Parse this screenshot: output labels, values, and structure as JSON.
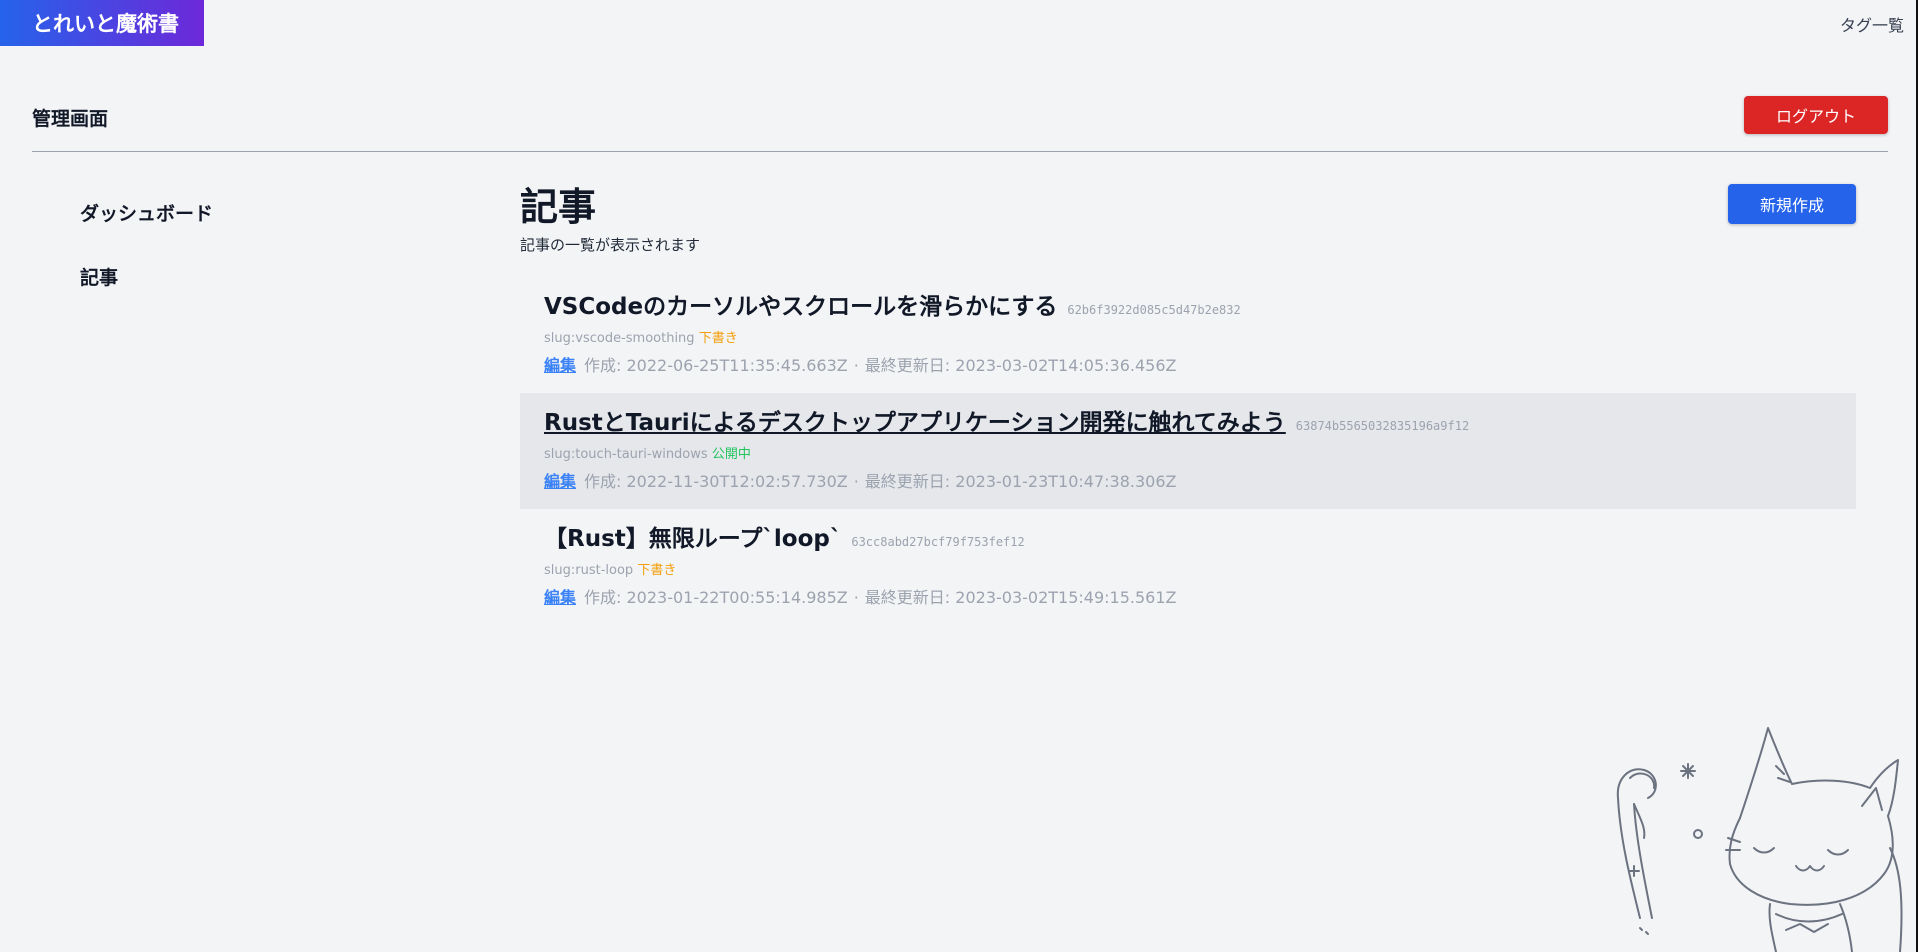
{
  "site": {
    "logo": "とれいと魔術書",
    "tags_link": "タグ一覧"
  },
  "admin": {
    "title": "管理画面",
    "logout_label": "ログアウト"
  },
  "sidebar": {
    "items": [
      {
        "label": "ダッシュボード"
      },
      {
        "label": "記事"
      }
    ]
  },
  "main": {
    "title": "記事",
    "description": "記事の一覧が表示されます",
    "new_label": "新規作成",
    "edit_label": "編集",
    "created_prefix": "作成: ",
    "updated_prefix": "最終更新日: ",
    "separator": "·",
    "articles": [
      {
        "title": "VSCodeのカーソルやスクロールを滑らかにする",
        "id": "62b6f3922d085c5d47b2e832",
        "slug": "slug:vscode-smoothing",
        "status": "下書き",
        "created": "2022-06-25T11:35:45.663Z",
        "updated": "2023-03-02T14:05:36.456Z"
      },
      {
        "title": "RustとTauriによるデスクトップアプリケーション開発に触れてみよう",
        "id": "63874b5565032835196a9f12",
        "slug": "slug:touch-tauri-windows",
        "status": "公開中",
        "created": "2022-11-30T12:02:57.730Z",
        "updated": "2023-01-23T10:47:38.306Z"
      },
      {
        "title": "【Rust】無限ループ`loop`",
        "id": "63cc8abd27bcf79f753fef12",
        "slug": "slug:rust-loop",
        "status": "下書き",
        "created": "2023-01-22T00:55:14.985Z",
        "updated": "2023-03-02T15:49:15.561Z"
      }
    ]
  },
  "colors": {
    "logo_gradient_start": "#2563eb",
    "logo_gradient_end": "#6d28d9",
    "logout": "#dc2626",
    "new": "#2563eb",
    "draft": "#f59e0b",
    "published": "#22c55e",
    "edit_link": "#3b82f6"
  },
  "icons": {
    "mascot": "cat-wizard-illustration"
  }
}
